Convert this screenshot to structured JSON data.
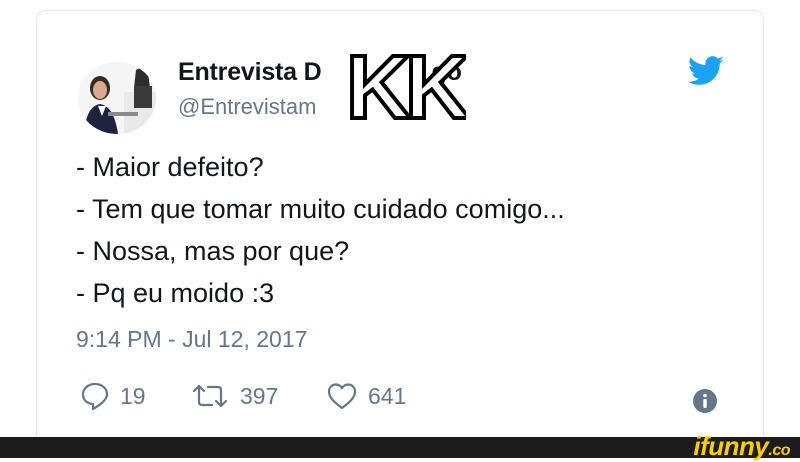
{
  "tweet": {
    "display_name": "Entrevista D",
    "display_name_suffix": "go",
    "handle": "@Entrevistam",
    "lines": [
      "- Maior defeito?",
      "- Tem que tomar muito cuidado comigo...",
      "- Nossa, mas por que?",
      "- Pq eu moido :3"
    ],
    "timestamp": "9:14 PM - Jul 12, 2017",
    "stats": {
      "replies": "19",
      "retweets": "397",
      "likes": "641"
    }
  },
  "sticker": {
    "text": "KK"
  },
  "icons": {
    "bird": "twitter-bird-icon",
    "reply": "reply-icon",
    "retweet": "retweet-icon",
    "like": "heart-icon",
    "info": "info-icon"
  },
  "watermark": {
    "brand": "ifunny",
    "suffix": ".co"
  },
  "colors": {
    "twitter_blue": "#1da1f2",
    "text": "#14171a",
    "muted": "#657786",
    "watermark": "#ffcc00",
    "footer": "#1c1c1c"
  }
}
